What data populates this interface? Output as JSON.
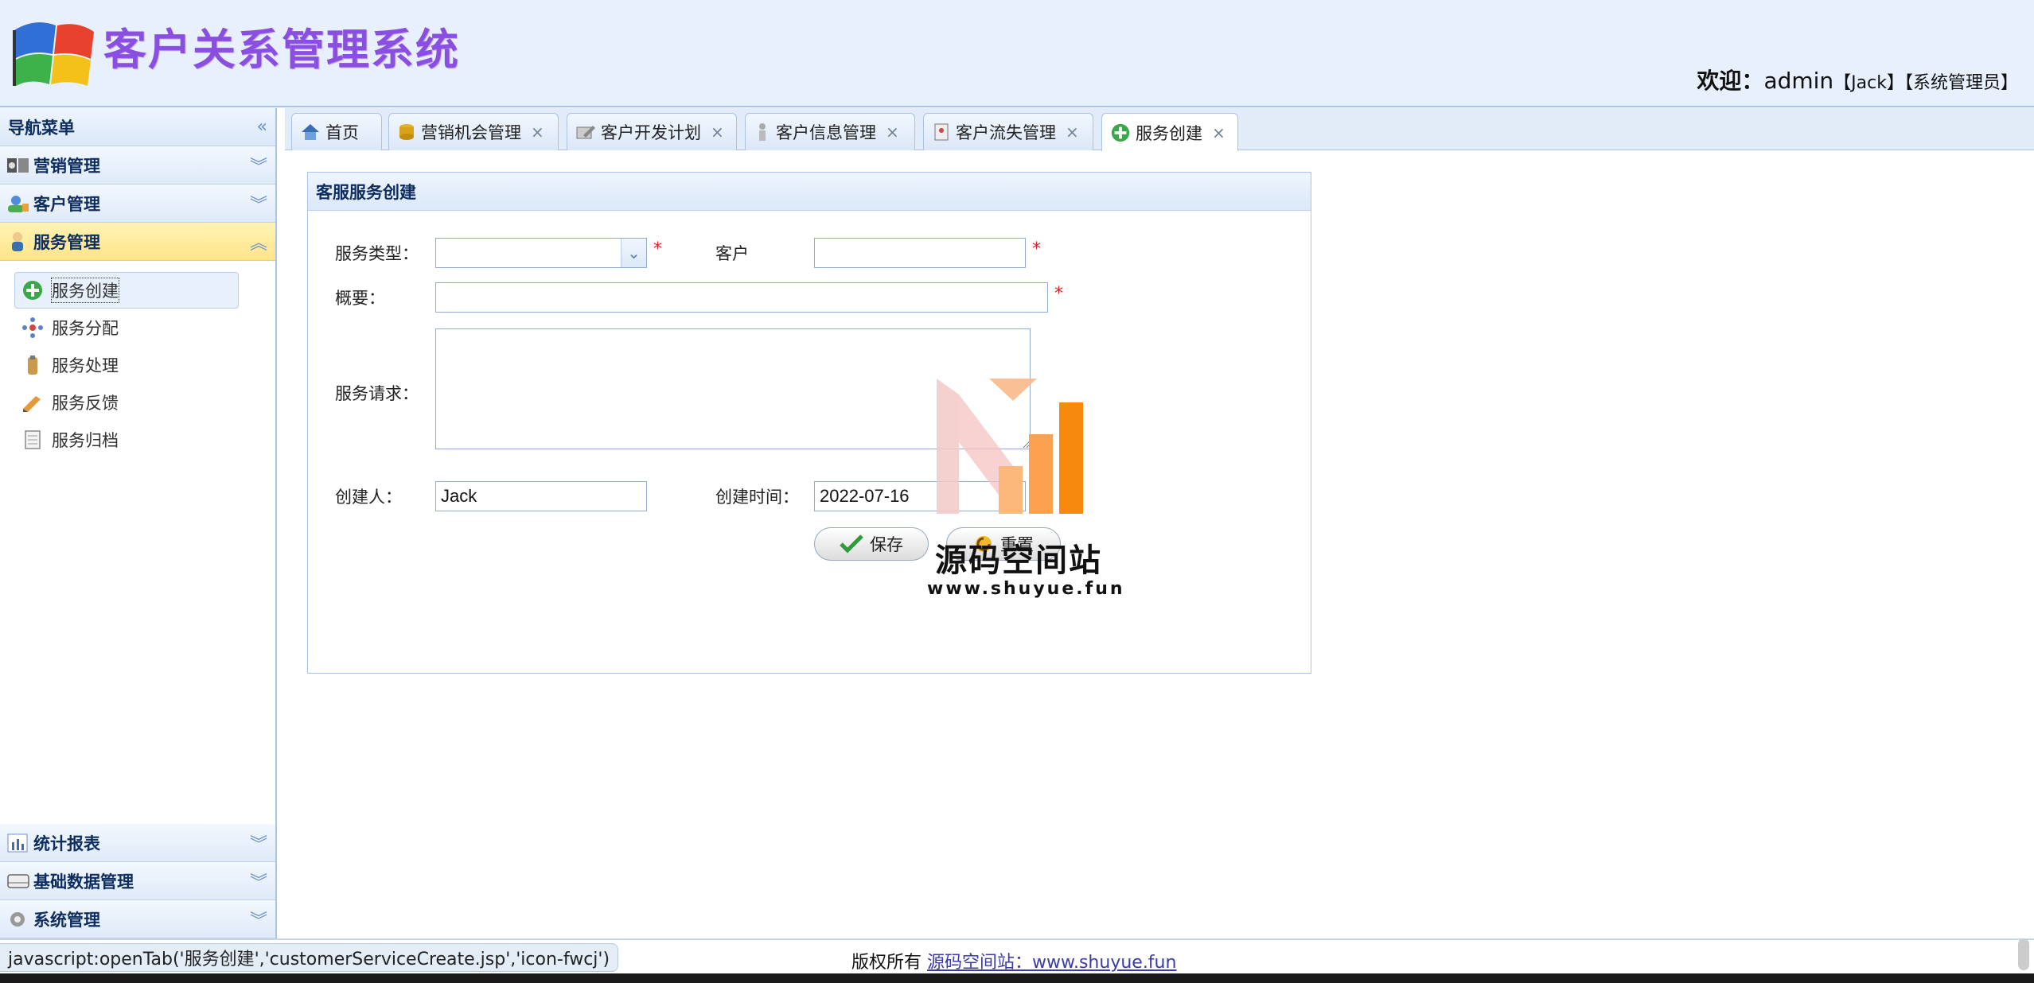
{
  "header": {
    "app_title": "客户关系管理系统",
    "welcome_prefix": "欢迎：",
    "username": "admin",
    "display_name": "【Jack】",
    "role": "【系统管理员】"
  },
  "sidebar": {
    "title": "导航菜单",
    "collapse_icon": "double-chevron-left-icon",
    "sections": {
      "marketing": {
        "label": "营销管理"
      },
      "customer": {
        "label": "客户管理"
      },
      "service": {
        "label": "服务管理"
      },
      "report": {
        "label": "统计报表"
      },
      "basic_data": {
        "label": "基础数据管理"
      },
      "system": {
        "label": "系统管理"
      }
    },
    "service_items": {
      "create": "服务创建",
      "assign": "服务分配",
      "process": "服务处理",
      "feedback": "服务反馈",
      "archive": "服务归档"
    }
  },
  "tabs": {
    "home": "首页",
    "marketing_chance": "营销机会管理",
    "dev_plan": "客户开发计划",
    "customer_info": "客户信息管理",
    "customer_loss": "客户流失管理",
    "service_create": "服务创建",
    "close_glyph": "×"
  },
  "form": {
    "panel_title": "客服服务创建",
    "service_type_label": "服务类型：",
    "service_type_value": "",
    "customer_label": "客户",
    "customer_value": "",
    "summary_label": "概要：",
    "summary_value": "",
    "request_label": "服务请求：",
    "request_value": "",
    "creator_label": "创建人：",
    "creator_value": "Jack",
    "created_time_label": "创建时间：",
    "created_time_value": "2022-07-16",
    "required_mark": "*",
    "save_label": "保存",
    "reset_label": "重置"
  },
  "watermark": {
    "title": "源码空间站",
    "url": "www.shuyue.fun"
  },
  "footer": {
    "status_url": "javascript:openTab('服务创建','customerServiceCreate.jsp','icon-fwcj')",
    "copyright_prefix": "版权所有",
    "copyright_link": "源码空间站：www.shuyue.fun"
  },
  "colors": {
    "accent": "#8a4fe0",
    "header_bg": "#e7f0fc",
    "active_section": "#ffe48a",
    "required": "#e0202a"
  }
}
